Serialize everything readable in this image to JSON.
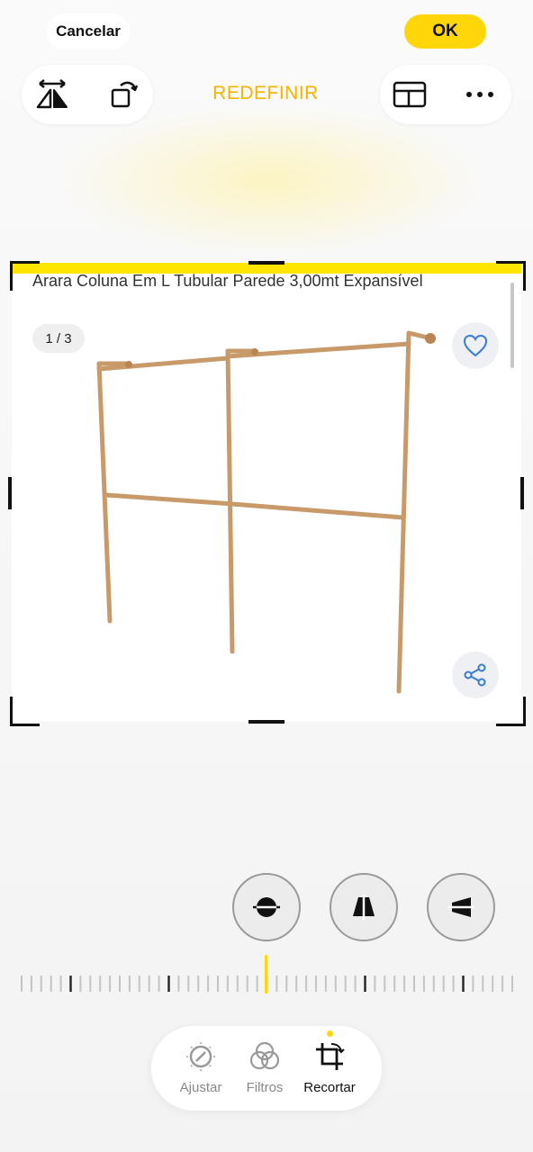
{
  "header": {
    "cancel_label": "Cancelar",
    "ok_label": "OK",
    "reset_label": "REDEFINIR"
  },
  "product": {
    "title": "Arara Coluna Em L Tubular Parede 3,00mt Expansível",
    "image_counter": "1 / 3"
  },
  "tabs": [
    {
      "label": "Ajustar",
      "icon": "adjust-dial-icon",
      "active": false
    },
    {
      "label": "Filtros",
      "icon": "filters-icon",
      "active": false
    },
    {
      "label": "Recortar",
      "icon": "crop-rotate-icon",
      "active": true
    }
  ],
  "colors": {
    "accent": "#ffd60a",
    "reset_text": "#f5b300",
    "rack": "#c89a6a",
    "link_blue": "#3a7bd5"
  }
}
